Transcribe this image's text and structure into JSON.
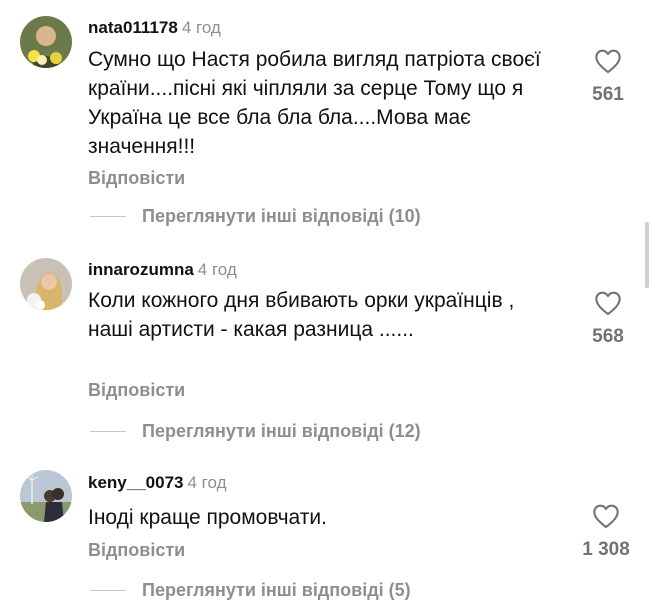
{
  "comments": [
    {
      "username": "nata011178",
      "time": "4 год",
      "text": "Сумно що Настя робила вигляд патріота своєї країни....пісні які чіпляли за серце Тому що я Україна це все бла бла бла....Мова має значення!!!",
      "reply_label": "Відповісти",
      "view_replies": "Переглянути інші відповіді (10)",
      "likes": "561"
    },
    {
      "username": "innarozumna",
      "time": "4 год",
      "text": "Коли кожного дня вбивають орки українців , наші артисти - какая разница ......",
      "reply_label": "Відповісти",
      "view_replies": "Переглянути інші відповіді (12)",
      "likes": "568"
    },
    {
      "username": "keny__0073",
      "time": "4 год",
      "text": "Іноді краще промовчати.",
      "reply_label": "Відповісти",
      "view_replies": "Переглянути інші відповіді (5)",
      "likes": "1 308"
    }
  ],
  "icons": {
    "like": "heart-outline-icon"
  },
  "colors": {
    "secondary_text": "#8e8e8e",
    "primary_text": "#111111"
  }
}
